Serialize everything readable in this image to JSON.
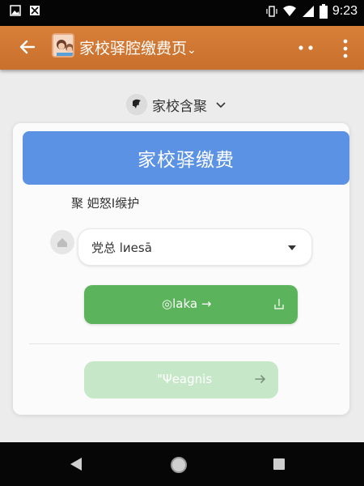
{
  "status_bar": {
    "time": "9:23",
    "icons": [
      "image-icon",
      "notification-icon",
      "vibrate-icon",
      "wifi-icon",
      "signal-icon",
      "battery-icon"
    ]
  },
  "app_bar": {
    "title": "家校驿腔缴费页",
    "title_suffix": "⌄",
    "more_label": "• •",
    "background": "#d0772f"
  },
  "school_selector": {
    "name": "家校含聚"
  },
  "card": {
    "header_title": "家校驿缴费",
    "subtitle": "聚 妑怒I缑护",
    "dropdown_value": "党总 lиesā",
    "primary_button_label": "◎laka →",
    "secondary_button_label": "\"Ψeagnis",
    "header_color": "#5c92e4",
    "primary_color": "#5bb35c",
    "secondary_color": "#c6e8c8"
  },
  "nav_bar": {
    "icons": [
      "back-triangle-icon",
      "home-circle-icon",
      "recents-square-icon"
    ]
  }
}
